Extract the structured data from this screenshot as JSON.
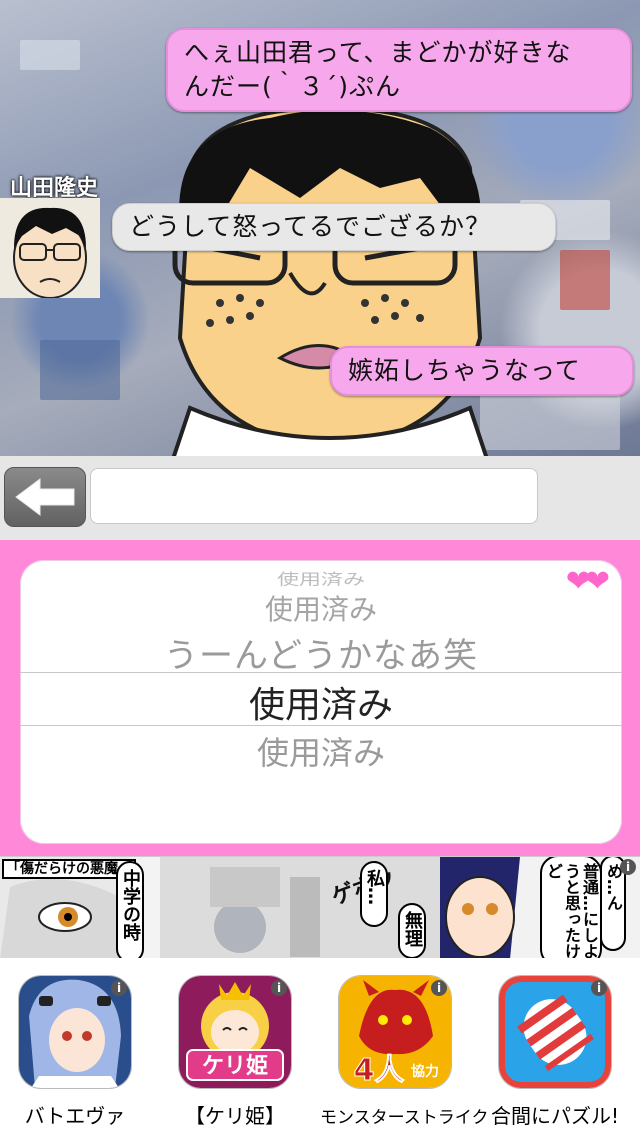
{
  "chat": {
    "speaker_name": "山田隆史",
    "messages": [
      {
        "side": "right",
        "text_line1": "へぇ山田君って、まどかが好きな",
        "text_line2": "んだー(｀３´)ぷん"
      },
      {
        "side": "left",
        "text": "どうして怒ってるでござるか？"
      },
      {
        "side": "right",
        "text": "嫉妬しちゃうなって"
      }
    ]
  },
  "input_row": {
    "back_icon": "left-arrow-icon",
    "message_value": ""
  },
  "picker": {
    "rows": [
      "使用済み",
      "使用済み",
      "うーんどうかなあ笑",
      "使用済み",
      "使用済み"
    ],
    "selected_index": 3,
    "hearts": "❤❤",
    "heart_color": "#ff66cc"
  },
  "manga_ad": {
    "title": "「傷だらけの悪魔」",
    "bubbles": [
      "中学の時",
      "私…",
      "無理",
      "普通…にしようと思ったけど",
      "め…ん"
    ],
    "sfx": "ゲボッ"
  },
  "app_ads": [
    {
      "label": "バトエヴァ",
      "icon": "evangelion-character-icon"
    },
    {
      "label": "【ケリ姫】",
      "icon": "keri-hime-icon"
    },
    {
      "label": "モンスターストライク",
      "icon": "monster-strike-icon"
    },
    {
      "label": "合間にパズル!",
      "icon": "candy-puzzle-icon"
    }
  ],
  "colors": {
    "bubble_pink": "#f7a8ec",
    "bubble_gray": "#e8e8e8",
    "picker_background": "#ff88d9"
  }
}
